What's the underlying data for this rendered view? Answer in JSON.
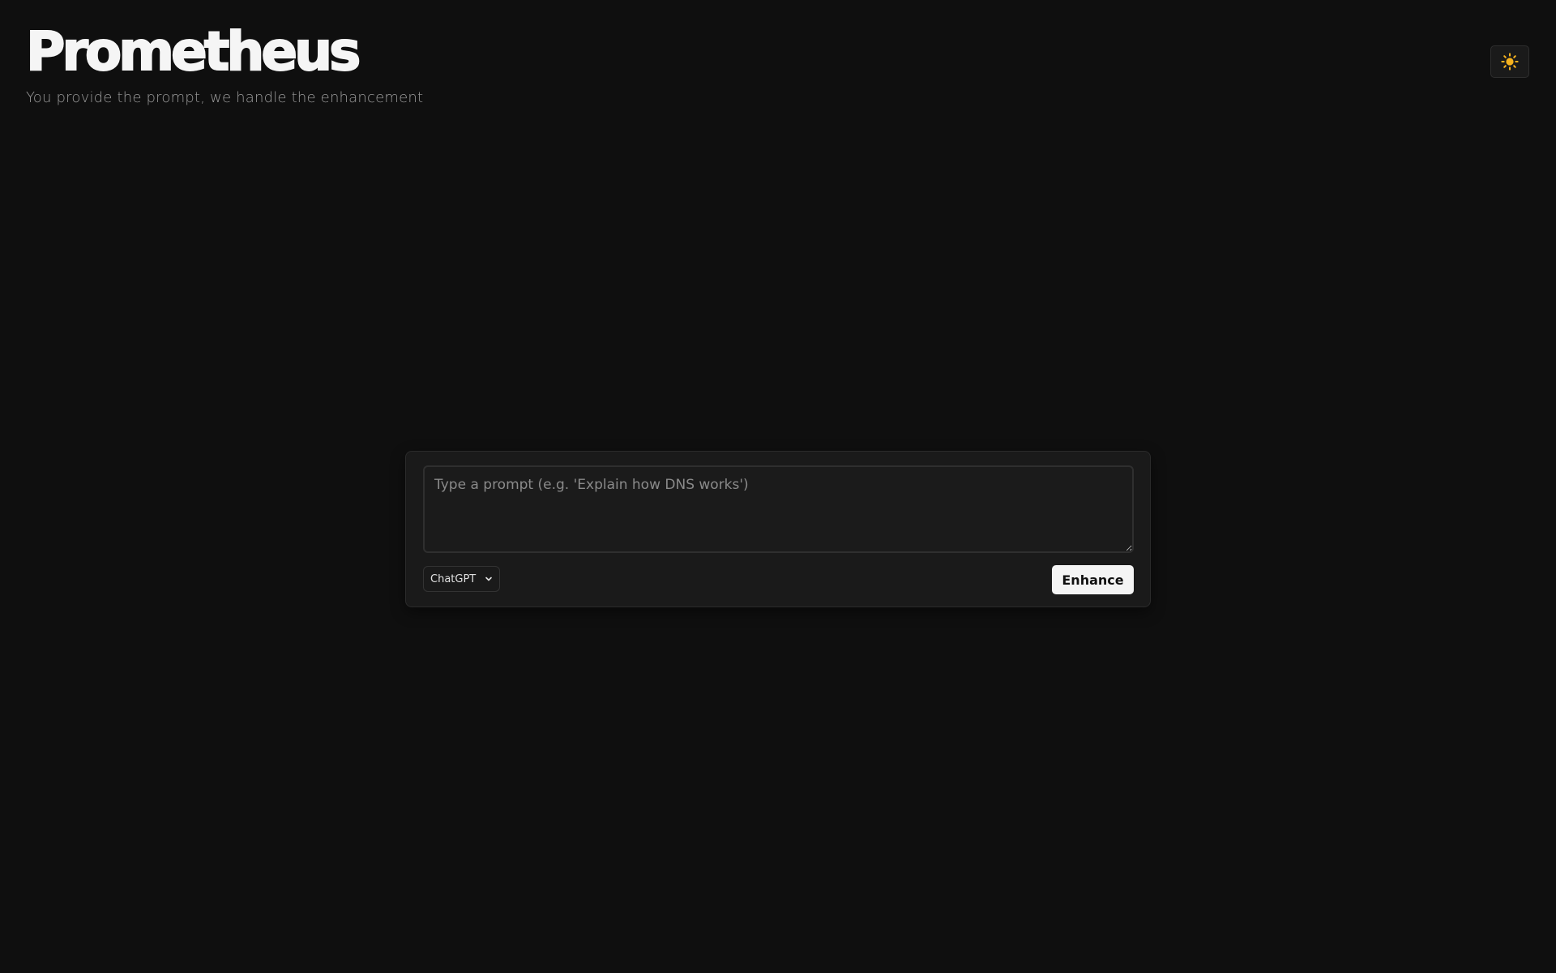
{
  "header": {
    "title": "Prometheus",
    "tagline": "You provide the prompt, we handle the enhancement"
  },
  "theme_toggle": {
    "icon": "sun-icon",
    "icon_color": "#f5b21f"
  },
  "composer": {
    "prompt": {
      "value": "",
      "placeholder": "Type a prompt (e.g. 'Explain how DNS works')"
    },
    "model_select": {
      "selected": "ChatGPT"
    },
    "enhance_label": "Enhance"
  },
  "colors": {
    "background": "#0f0f0f",
    "card": "#1a1a1a",
    "button": "#f4f4f4"
  }
}
